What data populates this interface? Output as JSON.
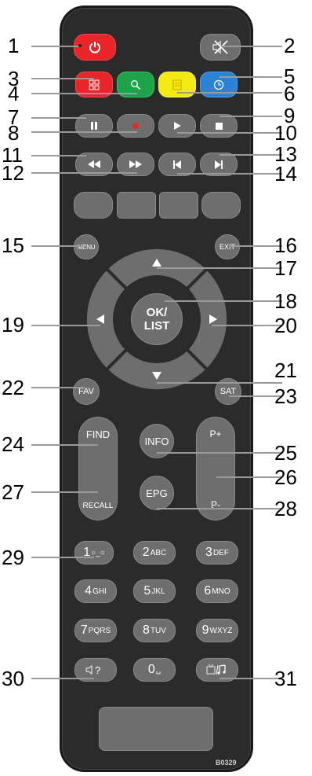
{
  "callouts": [
    "1",
    "2",
    "3",
    "4",
    "5",
    "6",
    "7",
    "8",
    "9",
    "10",
    "11",
    "12",
    "13",
    "14",
    "15",
    "16",
    "17",
    "18",
    "19",
    "20",
    "21",
    "22",
    "23",
    "24",
    "25",
    "26",
    "27",
    "28",
    "29",
    "30",
    "31"
  ],
  "buttons": {
    "menu": "MENU",
    "exit": "EXIT",
    "ok": "OK/",
    "list": "LIST",
    "fav": "FAV",
    "sat": "SAT",
    "find": "FIND",
    "recall": "RECALL",
    "info": "INFO",
    "epg": "EPG",
    "p_plus": "P+",
    "p_minus": "P-",
    "keys": [
      {
        "digit": "1",
        "letters": "○_○"
      },
      {
        "digit": "2",
        "letters": "ABC"
      },
      {
        "digit": "3",
        "letters": "DEF"
      },
      {
        "digit": "4",
        "letters": "GHI"
      },
      {
        "digit": "5",
        "letters": "JKL"
      },
      {
        "digit": "6",
        "letters": "MNO"
      },
      {
        "digit": "7",
        "letters": "PQRS"
      },
      {
        "digit": "8",
        "letters": "TUV"
      },
      {
        "digit": "9",
        "letters": "WXYZ"
      },
      {
        "digit": "0",
        "letters": "␣"
      }
    ]
  },
  "model_code": "B0329",
  "colors": {
    "power": "#e8262a",
    "red": "#e8262a",
    "green": "#1fa34a",
    "yellow": "#f2ea10",
    "blue": "#2b83d6",
    "record_dot": "#e8262a"
  },
  "icons": [
    "power-icon",
    "mute-icon",
    "grid-icon",
    "zoom-icon",
    "page-icon",
    "clock-icon",
    "pause-icon",
    "record-icon",
    "play-icon",
    "stop-icon",
    "rewind-icon",
    "fast-forward-icon",
    "previous-icon",
    "next-icon",
    "up-arrow-icon",
    "down-arrow-icon",
    "left-arrow-icon",
    "right-arrow-icon",
    "speaker-question-icon",
    "tv-music-icon"
  ]
}
